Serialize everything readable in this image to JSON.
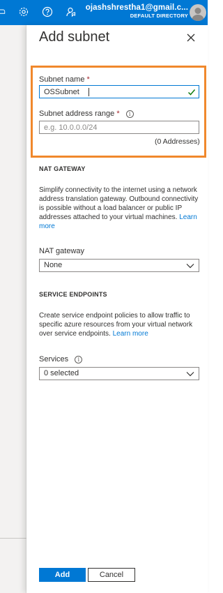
{
  "header": {
    "account_email": "ojashshrestha1@gmail.c...",
    "directory": "DEFAULT DIRECTORY"
  },
  "panel": {
    "title": "Add subnet",
    "subnet_name": {
      "label": "Subnet name",
      "required_mark": "*",
      "value": "OSSubnet"
    },
    "address_range": {
      "label": "Subnet address range",
      "required_mark": "*",
      "placeholder": "e.g. 10.0.0.0/24",
      "value": "",
      "addresses_note": "(0 Addresses)"
    },
    "nat": {
      "section_title": "NAT GATEWAY",
      "description": "Simplify connectivity to the internet using a network address translation gateway. Outbound connectivity is possible without a load balancer or public IP addresses attached to your virtual machines.",
      "learn_more": "Learn more",
      "label": "NAT gateway",
      "selected": "None"
    },
    "service_endpoints": {
      "section_title": "SERVICE ENDPOINTS",
      "description": "Create service endpoint policies to allow traffic to specific azure resources from your virtual network over service endpoints.",
      "learn_more": "Learn more",
      "label": "Services",
      "selected": "0 selected"
    },
    "buttons": {
      "add": "Add",
      "cancel": "Cancel"
    }
  },
  "icons": [
    "notifications-icon",
    "settings-icon",
    "help-icon",
    "feedback-icon",
    "avatar-icon",
    "close-icon",
    "check-icon",
    "info-icon",
    "chevron-down-icon"
  ],
  "colors": {
    "topbar": "#0078d4",
    "accent": "#0078d4",
    "highlight": "#f0882c",
    "required": "#a4262c",
    "valid_check": "#107c10"
  }
}
